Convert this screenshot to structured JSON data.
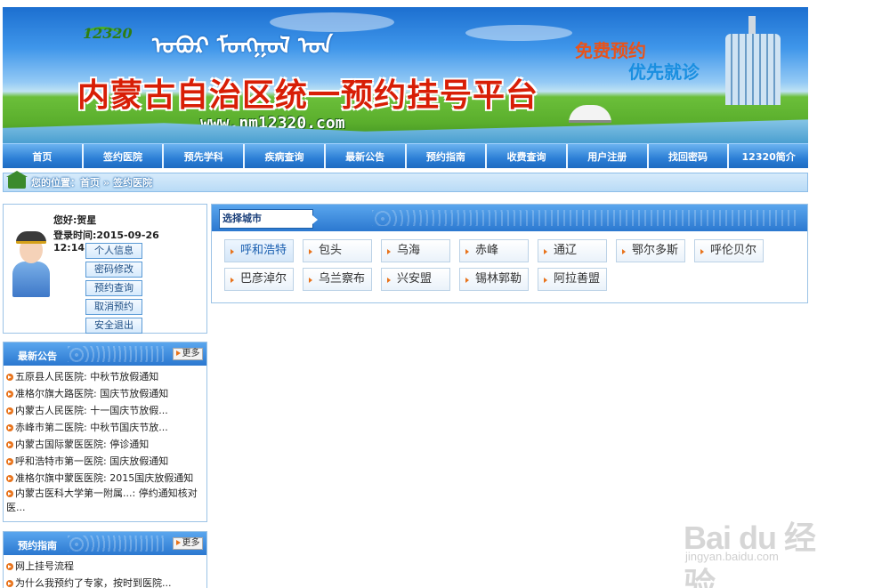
{
  "banner": {
    "logo_text": "12320",
    "mongolian_script": "ᠣᠪᠣᠷ ᠮᠣᠩᠭᠣᠯ ᠤᠨ",
    "title": "内蒙古自治区统一预约挂号平台",
    "url": "www.nm12320.com",
    "slogan_1": "免费预约",
    "slogan_2": "优先就诊"
  },
  "nav": {
    "items": [
      "首页",
      "签约医院",
      "预先学科",
      "疾病查询",
      "最新公告",
      "预约指南",
      "收费查询",
      "用户注册",
      "找回密码",
      "12320简介"
    ]
  },
  "breadcrumb": {
    "label": "您的位置：",
    "home": "首页",
    "separator": "»",
    "current": "签约医院"
  },
  "user": {
    "greeting": "您好:贺星",
    "login_time": "登录时间:2015-09-26 12:14:06",
    "buttons": [
      "个人信息",
      "密码修改",
      "预约查询",
      "取消预约",
      "安全退出"
    ]
  },
  "notices": {
    "title": "最新公告",
    "more": "更多",
    "items": [
      "五原县人民医院: 中秋节放假通知",
      "准格尔旗大路医院: 国庆节放假通知",
      "内蒙古人民医院: 十一国庆节放假...",
      "赤峰市第二医院: 中秋节国庆节放...",
      "内蒙古国际蒙医医院: 停诊通知",
      "呼和浩特市第一医院: 国庆放假通知",
      "准格尔旗中蒙医医院: 2015国庆放假通知",
      "内蒙古医科大学第一附属...: 停约通知核对医..."
    ]
  },
  "guide": {
    "title": "预约指南",
    "more": "更多",
    "items": [
      "网上挂号流程",
      "为什么我预约了专家，按时到医院..."
    ]
  },
  "city": {
    "selector_label": "选择城市",
    "cities": [
      "呼和浩特",
      "包头",
      "乌海",
      "赤峰",
      "通辽",
      "鄂尔多斯",
      "呼伦贝尔",
      "巴彦淖尔",
      "乌兰察布",
      "兴安盟",
      "锡林郭勒",
      "阿拉善盟"
    ],
    "active": "呼和浩特"
  },
  "watermark": {
    "logo": "Bai du 经验",
    "sub": "jingyan.baidu.com"
  }
}
